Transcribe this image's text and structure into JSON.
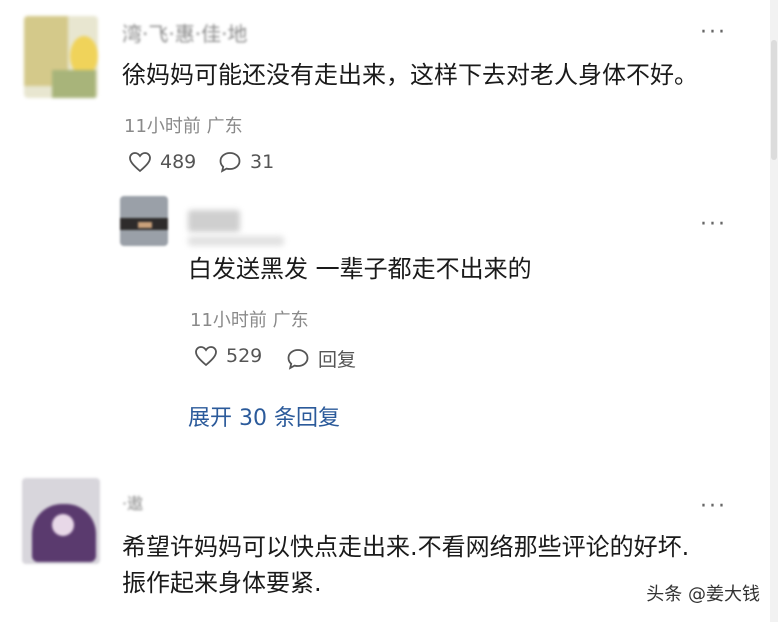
{
  "comments": [
    {
      "username": "湾·飞·惠·佳·地",
      "text": "徐妈妈可能还没有走出来，这样下去对老人身体不好。",
      "time_location": "11小时前 广东",
      "likes": "489",
      "replies_count": "31",
      "more": "···"
    },
    {
      "username": "",
      "text": "白发送黑发 一辈子都走不出来的",
      "time_location": "11小时前 广东",
      "likes": "529",
      "reply_label": "回复",
      "more": "···"
    },
    {
      "username": "·遨",
      "text_line1": "希望许妈妈可以快点走出来.不看网络那些评论的好坏.",
      "text_line2": "振作起来身体要紧.",
      "more": "···"
    }
  ],
  "expand_replies": "展开 30 条回复",
  "watermark": "头条 @姜大钱",
  "icons": {
    "like": "heart-outline-icon",
    "comment": "speech-bubble-icon",
    "more": "more-dots-icon"
  },
  "colors": {
    "link": "#2b5a9a",
    "meta": "#8a8a8a",
    "text": "#1a1a1a"
  }
}
